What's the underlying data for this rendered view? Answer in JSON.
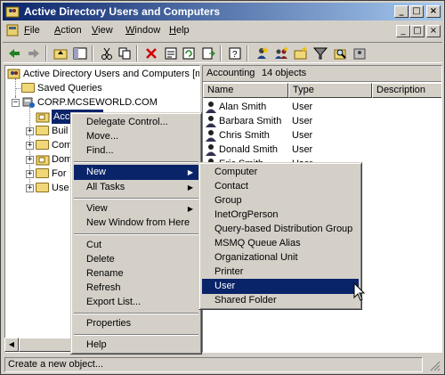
{
  "window": {
    "title": "Active Directory Users and Computers"
  },
  "title_buttons": {
    "minimize": "_",
    "maximize": "□",
    "close": "×"
  },
  "menubar": {
    "items": [
      {
        "label": "File",
        "accel": "F",
        "rest": "ile"
      },
      {
        "label": "Action",
        "accel": "A",
        "rest": "ction"
      },
      {
        "label": "View",
        "accel": "V",
        "rest": "iew"
      },
      {
        "label": "Window",
        "accel": "W",
        "rest": "indow"
      },
      {
        "label": "Help",
        "accel": "H",
        "rest": "elp"
      }
    ]
  },
  "tree": {
    "root": "Active Directory Users and Computers [mc:",
    "saved_queries": "Saved Queries",
    "domain": "CORP.MCSEWORLD.COM",
    "selected": "Accounting",
    "children": [
      "Buil",
      "Com",
      "Dom",
      "For",
      "Use"
    ]
  },
  "rightpane": {
    "header_name": "Accounting",
    "header_count": "14 objects",
    "columns": [
      "Name",
      "Type",
      "Description"
    ],
    "rows": [
      {
        "name": "Alan Smith",
        "type": "User"
      },
      {
        "name": "Barbara Smith",
        "type": "User"
      },
      {
        "name": "Chris Smith",
        "type": "User"
      },
      {
        "name": "Donald Smith",
        "type": "User"
      },
      {
        "name": "Eric Smith",
        "type": "User"
      }
    ]
  },
  "context_menu": {
    "items": [
      {
        "label": "Delegate Control...",
        "accel": "C"
      },
      {
        "label": "Move...",
        "accel": "v"
      },
      {
        "label": "Find...",
        "accel": "i"
      },
      {
        "label": "New",
        "accel": "N",
        "submenu": true,
        "selected": true
      },
      {
        "label": "All Tasks",
        "accel": "K",
        "submenu": true
      },
      {
        "label": "View",
        "accel": "V",
        "submenu": true
      },
      {
        "label": "New Window from Here",
        "accel": "W"
      },
      {
        "label": "Cut",
        "accel": "t"
      },
      {
        "label": "Delete",
        "accel": "D"
      },
      {
        "label": "Rename",
        "accel": "m"
      },
      {
        "label": "Refresh",
        "accel": "F"
      },
      {
        "label": "Export List...",
        "accel": "L"
      },
      {
        "label": "Properties",
        "accel": "R"
      },
      {
        "label": "Help",
        "accel": "H"
      }
    ]
  },
  "new_submenu": {
    "items": [
      "Computer",
      "Contact",
      "Group",
      "InetOrgPerson",
      "Query-based Distribution Group",
      "MSMQ Queue Alias",
      "Organizational Unit",
      "Printer",
      "User",
      "Shared Folder"
    ],
    "selected": "User"
  },
  "status": {
    "text": "Create a new object..."
  },
  "colors": {
    "selection": "#0a246a",
    "title_start": "#0a246a",
    "title_end": "#a6caf0",
    "face": "#d4d0c8"
  }
}
